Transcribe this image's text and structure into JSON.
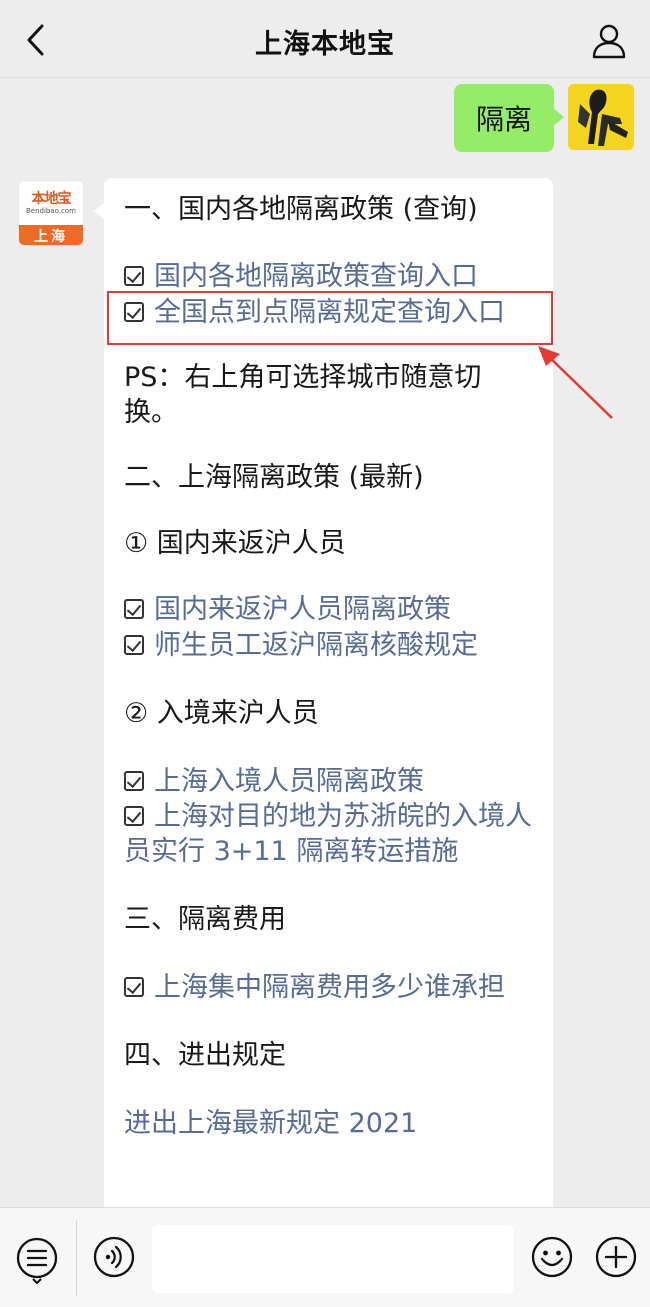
{
  "header": {
    "title": "上海本地宝",
    "back_icon": "chevron-left-icon",
    "profile_icon": "person-icon"
  },
  "sent_message": {
    "text": "隔离"
  },
  "bot": {
    "logo_name": "本地宝",
    "logo_domain": "Bendibao.com",
    "logo_city": "上海"
  },
  "article": {
    "section1_title": "一、国内各地隔离政策 (查询)",
    "section1_links": [
      "国内各地隔离政策查询入口",
      "全国点到点隔离规定查询入口"
    ],
    "ps_note": "PS：右上角可选择城市随意切换。",
    "section2_title": "二、上海隔离政策 (最新)",
    "sub1_title": "① 国内来返沪人员",
    "sub1_links": [
      "国内来返沪人员隔离政策",
      "师生员工返沪隔离核酸规定"
    ],
    "sub2_title": "② 入境来沪人员",
    "sub2_links": [
      "上海入境人员隔离政策",
      "上海对目的地为苏浙皖的入境人员实行 3+11 隔离转运措施"
    ],
    "section3_title": "三、隔离费用",
    "section3_links": [
      "上海集中隔离费用多少谁承担"
    ],
    "section4_title": "四、进出规定",
    "section4_link": "进出上海最新规定 2021"
  },
  "colors": {
    "link": "#576b95",
    "sent_bubble": "#95ec69",
    "highlight": "#e53b34",
    "background": "#ededed"
  },
  "bottom_bar": {
    "menu_icon": "list-menu-icon",
    "voice_icon": "voice-icon",
    "emoji_icon": "emoji-icon",
    "plus_icon": "plus-circle-icon",
    "input_value": ""
  }
}
